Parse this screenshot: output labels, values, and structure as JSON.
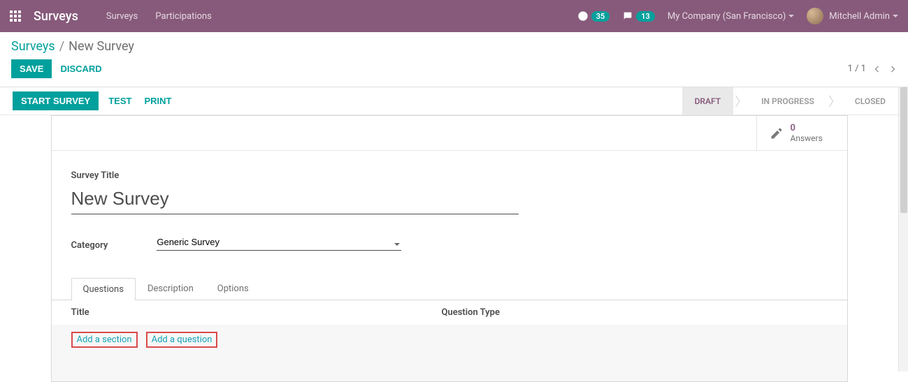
{
  "topbar": {
    "brand": "Surveys",
    "nav": {
      "surveys": "Surveys",
      "participations": "Participations"
    },
    "activity_count": "35",
    "message_count": "13",
    "company": "My Company (San Francisco)",
    "user": "Mitchell Admin"
  },
  "breadcrumb": {
    "root": "Surveys",
    "current": "New Survey"
  },
  "actions": {
    "save": "SAVE",
    "discard": "DISCARD"
  },
  "pager": {
    "text": "1 / 1"
  },
  "buttons": {
    "start": "START SURVEY",
    "test": "TEST",
    "print": "PRINT"
  },
  "stages": {
    "draft": "DRAFT",
    "in_progress": "IN PROGRESS",
    "closed": "CLOSED"
  },
  "statbox": {
    "count": "0",
    "label": "Answers"
  },
  "form": {
    "title_label": "Survey Title",
    "title_value": "New Survey",
    "category_label": "Category",
    "category_value": "Generic Survey"
  },
  "tabs": {
    "questions": "Questions",
    "description": "Description",
    "options": "Options"
  },
  "columns": {
    "title": "Title",
    "qtype": "Question Type"
  },
  "links": {
    "add_section": "Add a section",
    "add_question": "Add a question"
  }
}
